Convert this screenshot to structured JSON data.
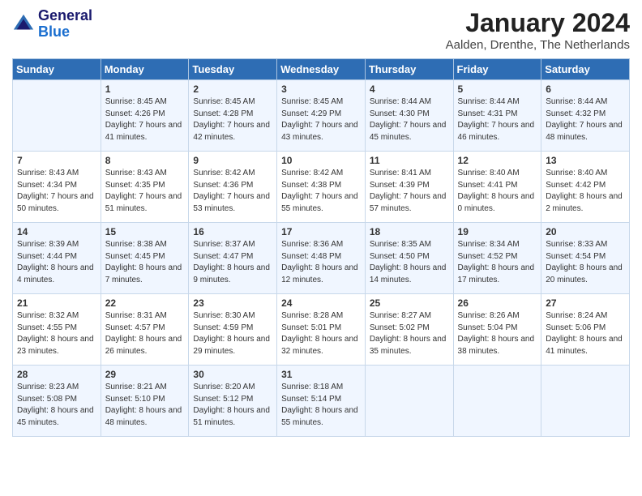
{
  "header": {
    "logo_line1": "General",
    "logo_line2": "Blue",
    "month": "January 2024",
    "location": "Aalden, Drenthe, The Netherlands"
  },
  "days_of_week": [
    "Sunday",
    "Monday",
    "Tuesday",
    "Wednesday",
    "Thursday",
    "Friday",
    "Saturday"
  ],
  "weeks": [
    [
      {
        "day": "",
        "sunrise": "",
        "sunset": "",
        "daylight": ""
      },
      {
        "day": "1",
        "sunrise": "Sunrise: 8:45 AM",
        "sunset": "Sunset: 4:26 PM",
        "daylight": "Daylight: 7 hours and 41 minutes."
      },
      {
        "day": "2",
        "sunrise": "Sunrise: 8:45 AM",
        "sunset": "Sunset: 4:28 PM",
        "daylight": "Daylight: 7 hours and 42 minutes."
      },
      {
        "day": "3",
        "sunrise": "Sunrise: 8:45 AM",
        "sunset": "Sunset: 4:29 PM",
        "daylight": "Daylight: 7 hours and 43 minutes."
      },
      {
        "day": "4",
        "sunrise": "Sunrise: 8:44 AM",
        "sunset": "Sunset: 4:30 PM",
        "daylight": "Daylight: 7 hours and 45 minutes."
      },
      {
        "day": "5",
        "sunrise": "Sunrise: 8:44 AM",
        "sunset": "Sunset: 4:31 PM",
        "daylight": "Daylight: 7 hours and 46 minutes."
      },
      {
        "day": "6",
        "sunrise": "Sunrise: 8:44 AM",
        "sunset": "Sunset: 4:32 PM",
        "daylight": "Daylight: 7 hours and 48 minutes."
      }
    ],
    [
      {
        "day": "7",
        "sunrise": "Sunrise: 8:43 AM",
        "sunset": "Sunset: 4:34 PM",
        "daylight": "Daylight: 7 hours and 50 minutes."
      },
      {
        "day": "8",
        "sunrise": "Sunrise: 8:43 AM",
        "sunset": "Sunset: 4:35 PM",
        "daylight": "Daylight: 7 hours and 51 minutes."
      },
      {
        "day": "9",
        "sunrise": "Sunrise: 8:42 AM",
        "sunset": "Sunset: 4:36 PM",
        "daylight": "Daylight: 7 hours and 53 minutes."
      },
      {
        "day": "10",
        "sunrise": "Sunrise: 8:42 AM",
        "sunset": "Sunset: 4:38 PM",
        "daylight": "Daylight: 7 hours and 55 minutes."
      },
      {
        "day": "11",
        "sunrise": "Sunrise: 8:41 AM",
        "sunset": "Sunset: 4:39 PM",
        "daylight": "Daylight: 7 hours and 57 minutes."
      },
      {
        "day": "12",
        "sunrise": "Sunrise: 8:40 AM",
        "sunset": "Sunset: 4:41 PM",
        "daylight": "Daylight: 8 hours and 0 minutes."
      },
      {
        "day": "13",
        "sunrise": "Sunrise: 8:40 AM",
        "sunset": "Sunset: 4:42 PM",
        "daylight": "Daylight: 8 hours and 2 minutes."
      }
    ],
    [
      {
        "day": "14",
        "sunrise": "Sunrise: 8:39 AM",
        "sunset": "Sunset: 4:44 PM",
        "daylight": "Daylight: 8 hours and 4 minutes."
      },
      {
        "day": "15",
        "sunrise": "Sunrise: 8:38 AM",
        "sunset": "Sunset: 4:45 PM",
        "daylight": "Daylight: 8 hours and 7 minutes."
      },
      {
        "day": "16",
        "sunrise": "Sunrise: 8:37 AM",
        "sunset": "Sunset: 4:47 PM",
        "daylight": "Daylight: 8 hours and 9 minutes."
      },
      {
        "day": "17",
        "sunrise": "Sunrise: 8:36 AM",
        "sunset": "Sunset: 4:48 PM",
        "daylight": "Daylight: 8 hours and 12 minutes."
      },
      {
        "day": "18",
        "sunrise": "Sunrise: 8:35 AM",
        "sunset": "Sunset: 4:50 PM",
        "daylight": "Daylight: 8 hours and 14 minutes."
      },
      {
        "day": "19",
        "sunrise": "Sunrise: 8:34 AM",
        "sunset": "Sunset: 4:52 PM",
        "daylight": "Daylight: 8 hours and 17 minutes."
      },
      {
        "day": "20",
        "sunrise": "Sunrise: 8:33 AM",
        "sunset": "Sunset: 4:54 PM",
        "daylight": "Daylight: 8 hours and 20 minutes."
      }
    ],
    [
      {
        "day": "21",
        "sunrise": "Sunrise: 8:32 AM",
        "sunset": "Sunset: 4:55 PM",
        "daylight": "Daylight: 8 hours and 23 minutes."
      },
      {
        "day": "22",
        "sunrise": "Sunrise: 8:31 AM",
        "sunset": "Sunset: 4:57 PM",
        "daylight": "Daylight: 8 hours and 26 minutes."
      },
      {
        "day": "23",
        "sunrise": "Sunrise: 8:30 AM",
        "sunset": "Sunset: 4:59 PM",
        "daylight": "Daylight: 8 hours and 29 minutes."
      },
      {
        "day": "24",
        "sunrise": "Sunrise: 8:28 AM",
        "sunset": "Sunset: 5:01 PM",
        "daylight": "Daylight: 8 hours and 32 minutes."
      },
      {
        "day": "25",
        "sunrise": "Sunrise: 8:27 AM",
        "sunset": "Sunset: 5:02 PM",
        "daylight": "Daylight: 8 hours and 35 minutes."
      },
      {
        "day": "26",
        "sunrise": "Sunrise: 8:26 AM",
        "sunset": "Sunset: 5:04 PM",
        "daylight": "Daylight: 8 hours and 38 minutes."
      },
      {
        "day": "27",
        "sunrise": "Sunrise: 8:24 AM",
        "sunset": "Sunset: 5:06 PM",
        "daylight": "Daylight: 8 hours and 41 minutes."
      }
    ],
    [
      {
        "day": "28",
        "sunrise": "Sunrise: 8:23 AM",
        "sunset": "Sunset: 5:08 PM",
        "daylight": "Daylight: 8 hours and 45 minutes."
      },
      {
        "day": "29",
        "sunrise": "Sunrise: 8:21 AM",
        "sunset": "Sunset: 5:10 PM",
        "daylight": "Daylight: 8 hours and 48 minutes."
      },
      {
        "day": "30",
        "sunrise": "Sunrise: 8:20 AM",
        "sunset": "Sunset: 5:12 PM",
        "daylight": "Daylight: 8 hours and 51 minutes."
      },
      {
        "day": "31",
        "sunrise": "Sunrise: 8:18 AM",
        "sunset": "Sunset: 5:14 PM",
        "daylight": "Daylight: 8 hours and 55 minutes."
      },
      {
        "day": "",
        "sunrise": "",
        "sunset": "",
        "daylight": ""
      },
      {
        "day": "",
        "sunrise": "",
        "sunset": "",
        "daylight": ""
      },
      {
        "day": "",
        "sunrise": "",
        "sunset": "",
        "daylight": ""
      }
    ]
  ]
}
